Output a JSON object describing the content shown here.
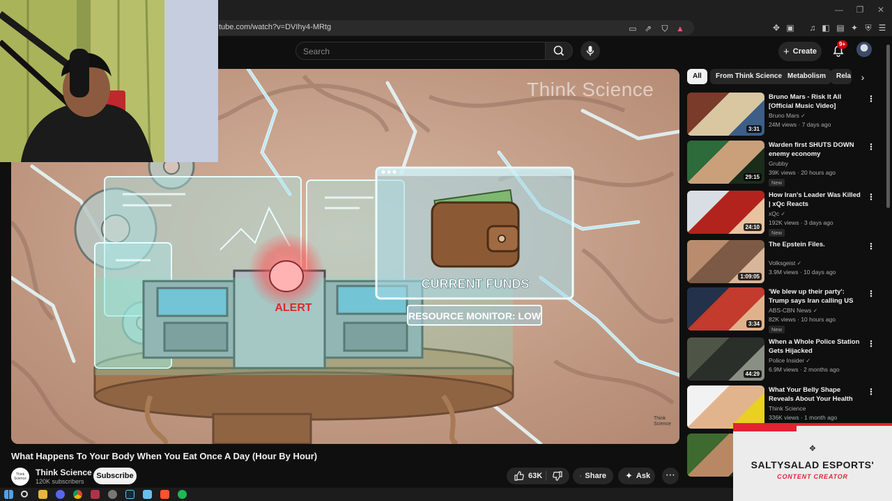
{
  "browser": {
    "url": "tube.com/watch?v=DVIhy4-MRtg",
    "window_controls": [
      "—",
      "❐",
      "✕"
    ]
  },
  "header": {
    "search_placeholder": "Search",
    "create_label": "Create",
    "notification_badge": "9+"
  },
  "player": {
    "watermark": "Think Science",
    "scene_labels": {
      "alert": "ALERT",
      "funds": "CURRENT FUNDS",
      "monitor": "RESOURCE MONITOR: LOW"
    },
    "corner_logo": "Think Science"
  },
  "video": {
    "title": "What Happens To Your Body When You Eat Once A Day (Hour By Hour)",
    "channel_name": "Think Science",
    "channel_avatar_text": "Think Science",
    "subscribers": "120K subscribers",
    "subscribe_label": "Subscribe",
    "like_count": "63K",
    "share_label": "Share",
    "ask_label": "Ask",
    "more_label": "⋯"
  },
  "sidebar": {
    "chips": [
      "All",
      "From Think Science",
      "Metabolism",
      "Rela"
    ],
    "recommendations": [
      {
        "title": "Bruno Mars - Risk It All [Official Music Video]",
        "channel": "Bruno Mars",
        "verified": true,
        "views": "24M views",
        "age": "7 days ago",
        "duration": "3:31",
        "is_new": false,
        "colors": [
          "#7a3b2a",
          "#d8c7a0",
          "#3c5e87"
        ]
      },
      {
        "title": "Warden first SHUTS DOWN enemy economy",
        "channel": "Grubby",
        "verified": false,
        "views": "39K views",
        "age": "20 hours ago",
        "duration": "29:15",
        "is_new": true,
        "colors": [
          "#2d6b3a",
          "#c9a07a",
          "#1b2c1b"
        ]
      },
      {
        "title": "How Iran's Leader Was Killed | xQc Reacts",
        "channel": "xQc",
        "verified": true,
        "views": "192K views",
        "age": "3 days ago",
        "duration": "24:10",
        "is_new": true,
        "colors": [
          "#d9dde4",
          "#b3231d",
          "#e8c3a0"
        ]
      },
      {
        "title": "The Epstein Files.",
        "channel": "Volksgeist",
        "verified": true,
        "views": "3.9M views",
        "age": "10 days ago",
        "duration": "1:09:05",
        "is_new": false,
        "colors": [
          "#b88c6d",
          "#7c5a45",
          "#d8b69a"
        ]
      },
      {
        "title": "'We blew up their party': Trump says Iran calling US about a ...",
        "channel": "ABS-CBN News",
        "verified": true,
        "views": "82K views",
        "age": "10 hours ago",
        "duration": "3:34",
        "is_new": true,
        "colors": [
          "#23324a",
          "#c23b2d",
          "#e0b28b"
        ]
      },
      {
        "title": "When a Whole Police Station Gets Hijacked",
        "channel": "Police Insider",
        "verified": true,
        "views": "6.9M views",
        "age": "2 months ago",
        "duration": "44:29",
        "is_new": false,
        "colors": [
          "#4e5547",
          "#2b2f2a",
          "#8a8f84"
        ]
      },
      {
        "title": "What Your Belly Shape Reveals About Your Health",
        "channel": "Think Science",
        "verified": false,
        "views": "336K views",
        "age": "1 month ago",
        "duration": "",
        "is_new": false,
        "colors": [
          "#f2f2f2",
          "#e2b48e",
          "#e8d11f"
        ]
      },
      {
        "title": "",
        "channel": "",
        "verified": false,
        "views": "",
        "age": "",
        "duration": "",
        "is_new": false,
        "colors": [
          "#3e6a2f",
          "#b88865",
          "#1d2a18"
        ]
      }
    ]
  },
  "overlay": {
    "name": "SALTYSALAD ESPORTS'",
    "role": "CONTENT CREATOR"
  },
  "colors": {
    "background": "#0f0f0f",
    "accent_red": "#cc0000",
    "overlay_red": "#e02431",
    "chip_bg": "#272727"
  },
  "taskbar_icons": [
    "windows-icon",
    "search-icon",
    "file-explorer-icon",
    "discord-icon",
    "chrome-icon",
    "app-icon",
    "globe-icon",
    "steam-icon",
    "brave-icon",
    "spotify-icon"
  ]
}
